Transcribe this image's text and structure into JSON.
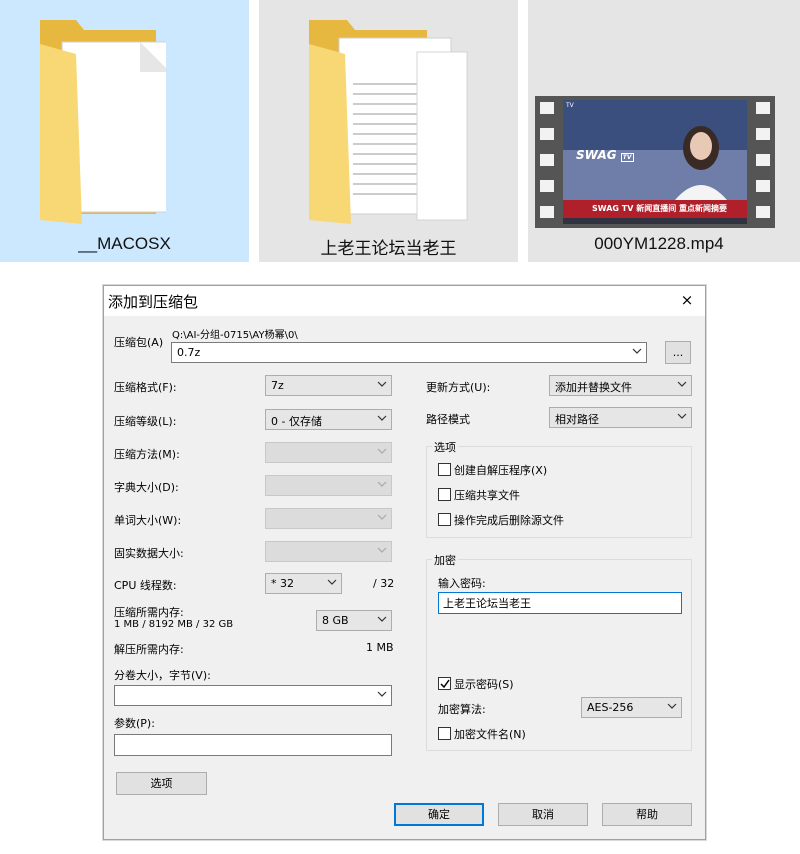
{
  "explorer": {
    "items": [
      {
        "name": "__MACOSX",
        "type": "folder",
        "selected": true
      },
      {
        "name": "上老王论坛当老王",
        "type": "folder",
        "selected": false
      },
      {
        "name": "000YM1228.mp4",
        "type": "video",
        "selected": false
      }
    ],
    "video_thumbnail": {
      "logo": "SWAG",
      "logo_badge": "TV",
      "ticker": "SWAG TV 新闻直播间  重点新闻摘要",
      "corner_badge": "TV"
    }
  },
  "dialog": {
    "title": "添加到压缩包",
    "close": "×",
    "archive": {
      "label": "压缩包(A)",
      "path": "Q:\\AI-分组-0715\\AY杨幂\\0\\",
      "value": "0.7z",
      "browse": "..."
    },
    "left": {
      "format": {
        "label": "压缩格式(F):",
        "value": "7z"
      },
      "level": {
        "label": "压缩等级(L):",
        "value": "0 - 仅存储"
      },
      "method": {
        "label": "压缩方法(M):",
        "value": ""
      },
      "dict": {
        "label": "字典大小(D):",
        "value": ""
      },
      "word": {
        "label": "单词大小(W):",
        "value": ""
      },
      "solid": {
        "label": "固实数据大小:",
        "value": ""
      },
      "cpu": {
        "label": "CPU 线程数:",
        "value": "* 32",
        "total": "/ 32"
      },
      "mem_comp": {
        "label": "压缩所需内存:",
        "detail": "1 MB / 8192 MB / 32 GB",
        "value": "8 GB"
      },
      "mem_decomp": {
        "label": "解压所需内存:",
        "value": "1 MB"
      },
      "volume": {
        "label": "分卷大小，字节(V):",
        "value": ""
      },
      "params": {
        "label": "参数(P):",
        "value": ""
      },
      "options_button": "选项"
    },
    "right": {
      "update": {
        "label": "更新方式(U):",
        "value": "添加并替换文件"
      },
      "path_mode": {
        "label": "路径模式",
        "value": "相对路径"
      },
      "options_group": "选项",
      "options": [
        {
          "label": "创建自解压程序(X)",
          "checked": false
        },
        {
          "label": "压缩共享文件",
          "checked": false
        },
        {
          "label": "操作完成后删除源文件",
          "checked": false
        }
      ],
      "encrypt_group": "加密",
      "password_label": "输入密码:",
      "password_value": "上老王论坛当老王",
      "show_password": {
        "label": "显示密码(S)",
        "checked": true
      },
      "algo_label": "加密算法:",
      "algo_value": "AES-256",
      "encrypt_names": {
        "label": "加密文件名(N)",
        "checked": false
      }
    },
    "buttons": {
      "ok": "确定",
      "cancel": "取消",
      "help": "帮助"
    }
  },
  "colors": {
    "selection": "#cce8ff",
    "tile_bg": "#e5e5e5",
    "accent": "#0078d7",
    "folder": "#f8d775"
  }
}
